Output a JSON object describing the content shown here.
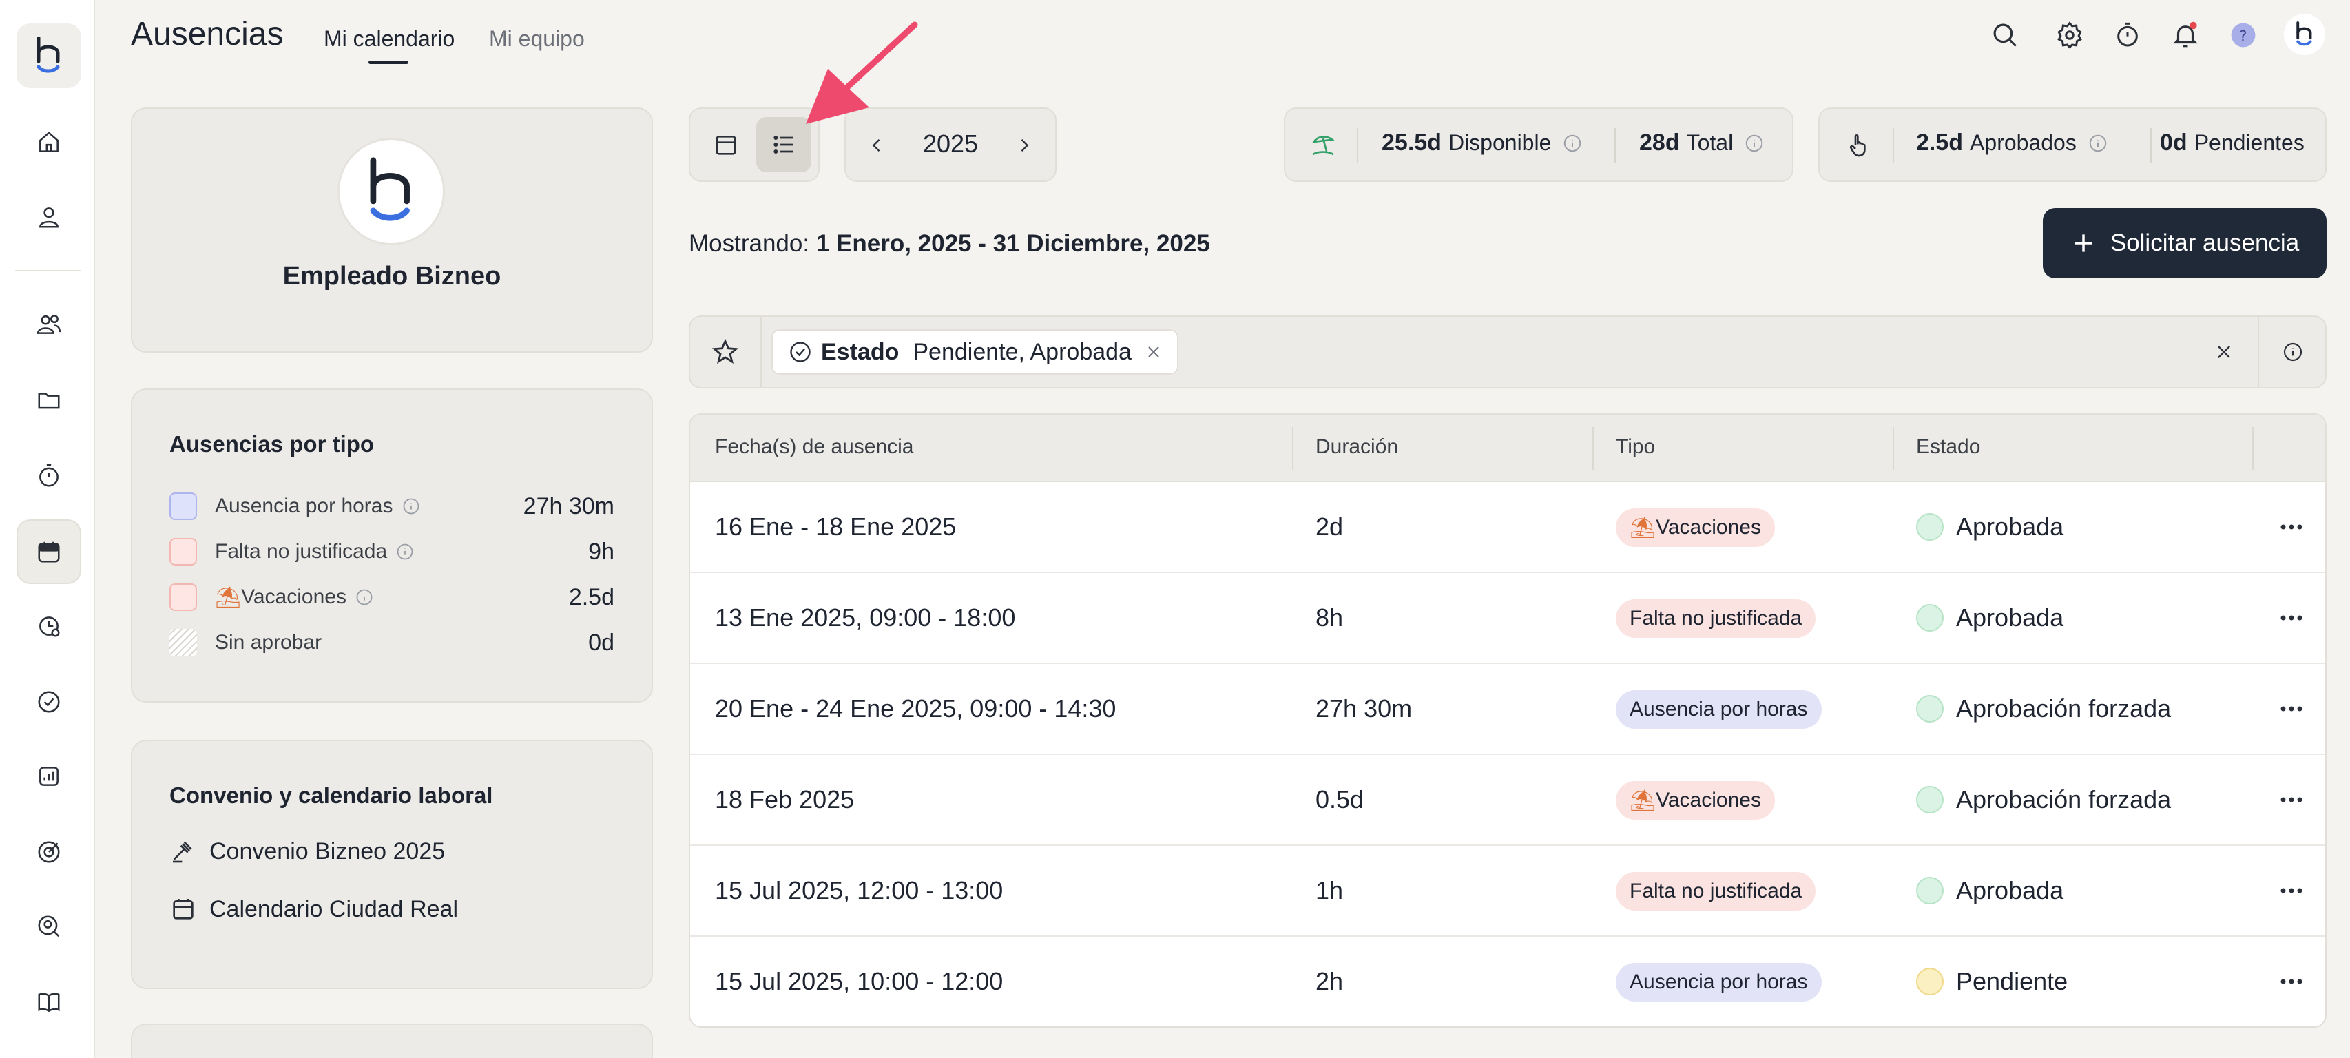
{
  "app": {
    "title": "Ausencias",
    "tabs": [
      {
        "label": "Mi calendario",
        "active": true
      },
      {
        "label": "Mi equipo",
        "active": false
      }
    ]
  },
  "rail": {
    "items": [
      "home-icon",
      "user-icon",
      "users-icon",
      "folder-icon",
      "stopwatch-icon",
      "calendar-icon",
      "clock-chart-icon",
      "check-circle-icon",
      "report-icon",
      "target-icon",
      "search-user-icon",
      "book-icon"
    ],
    "active": "calendar-icon"
  },
  "header_icons": [
    "search-icon",
    "gear-icon",
    "timer-icon",
    "bell-icon",
    "help-icon",
    "brand-avatar-icon"
  ],
  "profile": {
    "name": "Empleado Bizneo"
  },
  "types": {
    "title": "Ausencias por tipo",
    "items": [
      {
        "label": "Ausencia por horas",
        "value": "27h 30m",
        "color": "#dfe2fb",
        "info": true
      },
      {
        "label": "Falta no justificada",
        "value": "9h",
        "color": "#fde6e4",
        "info": true
      },
      {
        "label": "Vacaciones",
        "value": "2.5d",
        "color": "#fde6e4",
        "info": true,
        "emoji": "⛱"
      },
      {
        "label": "Sin aprobar",
        "value": "0d",
        "color": "#ffffff",
        "info": false
      }
    ]
  },
  "convenio": {
    "title": "Convenio y calendario laboral",
    "agreement": "Convenio Bizneo 2025",
    "calendar": "Calendario Ciudad Real"
  },
  "toolbar": {
    "year": "2025",
    "views": [
      "calendar-view",
      "list-view"
    ],
    "selected_view": "list-view"
  },
  "balance": {
    "available_value": "25.5d",
    "available_label": "Disponible",
    "total_value": "28d",
    "total_label": "Total"
  },
  "requests": {
    "approved_value": "2.5d",
    "approved_label": "Aprobados",
    "pending_value": "0d",
    "pending_label": "Pendientes"
  },
  "range": {
    "prefix": "Mostrando:",
    "value": "1 Enero, 2025 - 31 Diciembre, 2025"
  },
  "actions": {
    "request_absence": "Solicitar ausencia"
  },
  "filter": {
    "key": "Estado",
    "value": "Pendiente, Aprobada"
  },
  "table": {
    "headers": [
      "Fecha(s) de ausencia",
      "Duración",
      "Tipo",
      "Estado"
    ],
    "rows": [
      {
        "date": "16 Ene - 18 Ene 2025",
        "duration": "2d",
        "type": "Vacaciones",
        "type_kind": "vac",
        "status": "Aprobada",
        "status_kind": "green"
      },
      {
        "date": "13 Ene 2025, 09:00 - 18:00",
        "duration": "8h",
        "type": "Falta no justificada",
        "type_kind": "falta",
        "status": "Aprobada",
        "status_kind": "green"
      },
      {
        "date": "20 Ene - 24 Ene 2025, 09:00 - 14:30",
        "duration": "27h 30m",
        "type": "Ausencia por horas",
        "type_kind": "horas",
        "status": "Aprobación forzada",
        "status_kind": "green"
      },
      {
        "date": "18 Feb 2025",
        "duration": "0.5d",
        "type": "Vacaciones",
        "type_kind": "vac",
        "status": "Aprobación forzada",
        "status_kind": "green"
      },
      {
        "date": "15 Jul 2025, 12:00 - 13:00",
        "duration": "1h",
        "type": "Falta no justificada",
        "type_kind": "falta",
        "status": "Aprobada",
        "status_kind": "green"
      },
      {
        "date": "15 Jul 2025, 10:00 - 12:00",
        "duration": "2h",
        "type": "Ausencia por horas",
        "type_kind": "horas",
        "status": "Pendiente",
        "status_kind": "yellow"
      }
    ]
  },
  "colors": {
    "accent": "#1f2937",
    "brand_blue": "#3b6fe0",
    "annotation_arrow": "#ee4a6e"
  }
}
